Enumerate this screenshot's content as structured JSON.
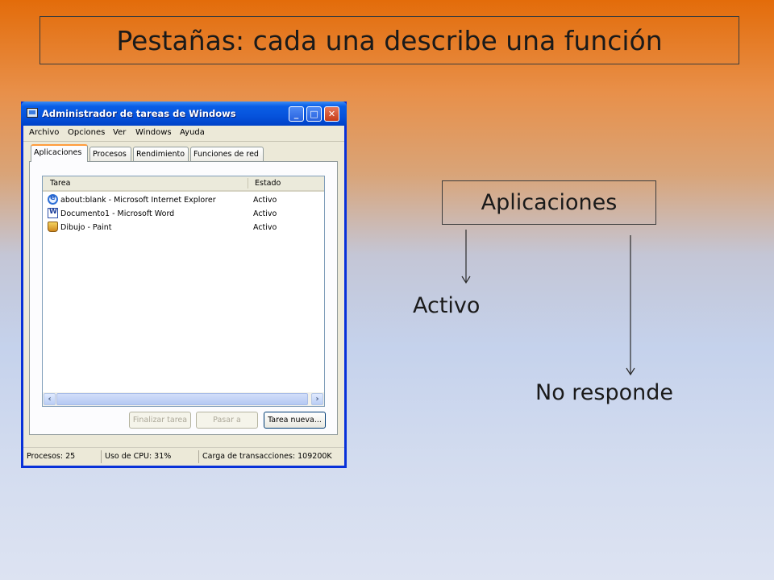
{
  "slide_title": "Pestañas: cada una describe una función",
  "window": {
    "title": "Administrador de tareas de Windows",
    "controls": [
      "minimize-icon",
      "maximize-icon",
      "close-icon"
    ],
    "menu": [
      "Archivo",
      "Opciones",
      "Ver",
      "Windows",
      "Ayuda"
    ],
    "tabs": [
      "Aplicaciones",
      "Procesos",
      "Rendimiento",
      "Funciones de red"
    ],
    "active_tab": "Aplicaciones",
    "columns": [
      "Tarea",
      "Estado"
    ],
    "rows": [
      {
        "task": "about:blank - Microsoft Internet Explorer",
        "state": "Activo",
        "icon": "internet-explorer-icon"
      },
      {
        "task": "Documento1 - Microsoft Word",
        "state": "Activo",
        "icon": "word-icon"
      },
      {
        "task": "Dibujo - Paint",
        "state": "Activo",
        "icon": "paint-icon"
      }
    ],
    "buttons": {
      "end_task": "Finalizar tarea",
      "switch_to": "Pasar a",
      "new_task": "Tarea nueva..."
    },
    "status": {
      "processes": "Procesos: 25",
      "cpu": "Uso de CPU: 31%",
      "commit": "Carga de transacciones: 109200K"
    }
  },
  "diagram": {
    "root": "Aplicaciones",
    "state_active": "Activo",
    "state_not_responding": "No responde"
  },
  "colors": {
    "accent_top": "#e36c0a",
    "xp_title_blue": "#0a5ee6"
  }
}
